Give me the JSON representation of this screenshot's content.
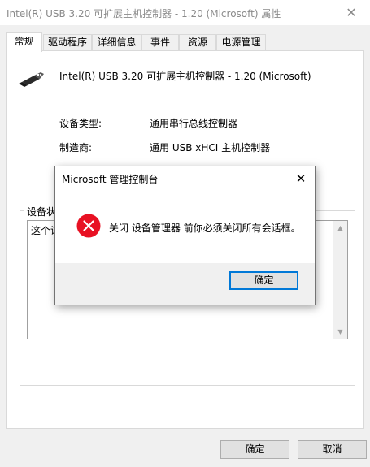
{
  "window": {
    "title": "Intel(R) USB 3.20 可扩展主机控制器 - 1.20 (Microsoft) 属性",
    "close_glyph": "✕"
  },
  "tabs": [
    {
      "label": "常规"
    },
    {
      "label": "驱动程序"
    },
    {
      "label": "详细信息"
    },
    {
      "label": "事件"
    },
    {
      "label": "资源"
    },
    {
      "label": "电源管理"
    }
  ],
  "device": {
    "name": "Intel(R) USB 3.20 可扩展主机控制器 - 1.20 (Microsoft)",
    "icon": "usb-plug-icon"
  },
  "properties": [
    {
      "label": "设备类型:",
      "value": "通用串行总线控制器"
    },
    {
      "label": "制造商:",
      "value": "通用 USB xHCI 主机控制器"
    }
  ],
  "status": {
    "group_label": "设备状",
    "text": "这个设"
  },
  "buttons": {
    "ok": "确定",
    "cancel": "取消"
  },
  "dialog": {
    "title": "Microsoft 管理控制台",
    "close_glyph": "✕",
    "message": "关闭 设备管理器 前你必须关闭所有会话框。",
    "ok": "确定",
    "icon": "error-icon"
  },
  "colors": {
    "error_red": "#e81123",
    "accent_blue": "#0078d7"
  }
}
